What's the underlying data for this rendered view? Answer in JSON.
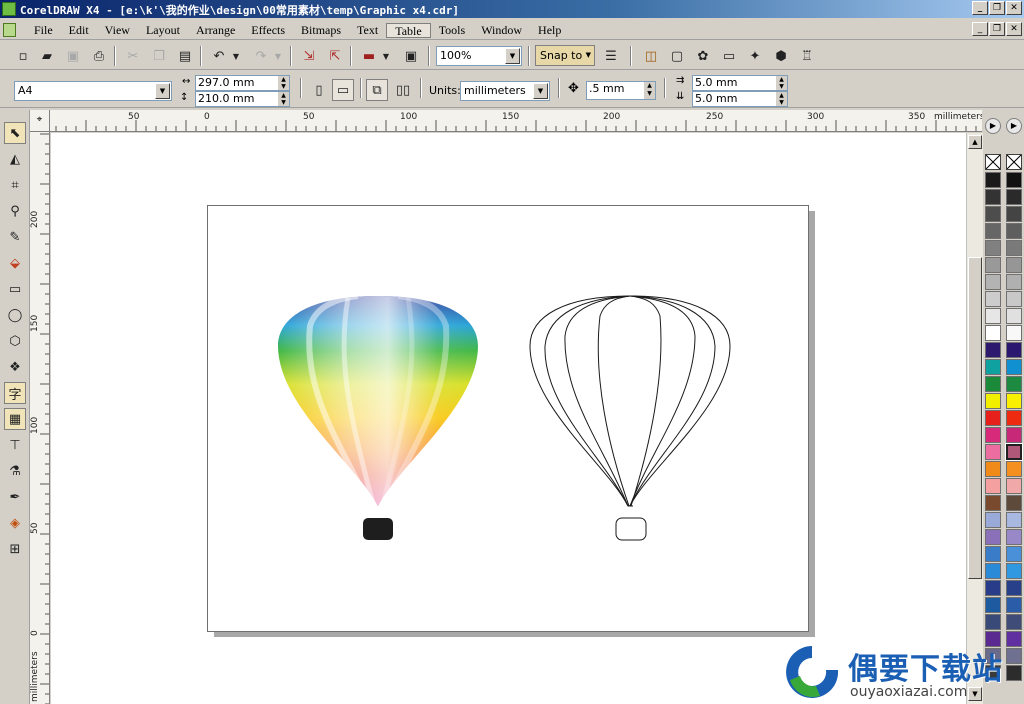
{
  "window": {
    "title": "CorelDRAW X4 - [e:\\k'\\我的作业\\design\\00常用素材\\temp\\Graphic x4.cdr]",
    "min_label": "_",
    "max_label": "❐",
    "close_label": "✕"
  },
  "menu": {
    "items": [
      "File",
      "Edit",
      "View",
      "Layout",
      "Arrange",
      "Effects",
      "Bitmaps",
      "Text",
      "Table",
      "Tools",
      "Window",
      "Help"
    ],
    "active": "Table"
  },
  "toolbar": {
    "zoom": "100%",
    "snap_label": "Snap to",
    "icons": [
      "new-icon",
      "open-icon",
      "save-icon",
      "print-icon",
      "cut-icon",
      "copy-icon",
      "paste-icon",
      "undo-icon",
      "redo-icon",
      "import-icon",
      "export-icon",
      "app-launcher-icon",
      "welcome-screen-icon",
      "options-icon"
    ]
  },
  "property_bar": {
    "paper_size": "A4",
    "width": "297.0 mm",
    "height": "210.0 mm",
    "units_label": "Units:",
    "units": "millimeters",
    "nudge": ".5 mm",
    "dup_x": "5.0 mm",
    "dup_y": "5.0 mm"
  },
  "ruler": {
    "h_ticks": [
      "50",
      "0",
      "50",
      "100",
      "150",
      "200",
      "250",
      "300",
      "350"
    ],
    "h_unit": "millimeters",
    "v_ticks": [
      "200",
      "150",
      "100",
      "50",
      "0"
    ],
    "v_unit": "millimeters"
  },
  "toolbox": {
    "tools": [
      "pick-tool",
      "shape-tool",
      "crop-tool",
      "zoom-tool",
      "freehand-tool",
      "smart-fill-tool",
      "rectangle-tool",
      "ellipse-tool",
      "polygon-tool",
      "basic-shapes-tool",
      "text-tool",
      "table-tool",
      "dimension-tool",
      "eyedropper-tool",
      "outline-tool",
      "fill-tool",
      "interactive-fill-tool"
    ],
    "text_tool_glyph": "字"
  },
  "palette": {
    "colors": [
      "#1a1a1a",
      "#333333",
      "#4d4d4d",
      "#666666",
      "#808080",
      "#999999",
      "#b3b3b3",
      "#cccccc",
      "#e6e6e6",
      "#ffffff",
      "#2d1a6e",
      "#0fa0a0",
      "#1a8a3a",
      "#f2ee00",
      "#e8201c",
      "#d82a7a",
      "#ec6ea0",
      "#f08a18",
      "#f4a0a0",
      "#7a4a2e",
      "#9aaad8",
      "#8a70b8",
      "#3a7cc8",
      "#2a8ad8",
      "#283c8a",
      "#1e5aa0",
      "#3a4a78",
      "#5a2a90",
      "#6a6a8a",
      "#3a3a3a"
    ],
    "colors2": [
      "#111111",
      "#2a2a2a",
      "#444444",
      "#5e5e5e",
      "#7a7a7a",
      "#969696",
      "#b0b0b0",
      "#c8c8c8",
      "#e0e0e0",
      "#f8f8f8",
      "#2a1870",
      "#1090d0",
      "#1c8a40",
      "#f8f000",
      "#ee2a10",
      "#c82878",
      "#b05878",
      "#f49020",
      "#f0a8a8",
      "#5e4a3a",
      "#a8b8e0",
      "#9888c8",
      "#4a90d8",
      "#3098e0",
      "#28408a",
      "#2a5ca8",
      "#404c78",
      "#6030a0",
      "#707090",
      "#2c2c2c"
    ]
  },
  "watermark": {
    "cn": "偶要下载站",
    "en": "ouyaoxiazai.com"
  }
}
